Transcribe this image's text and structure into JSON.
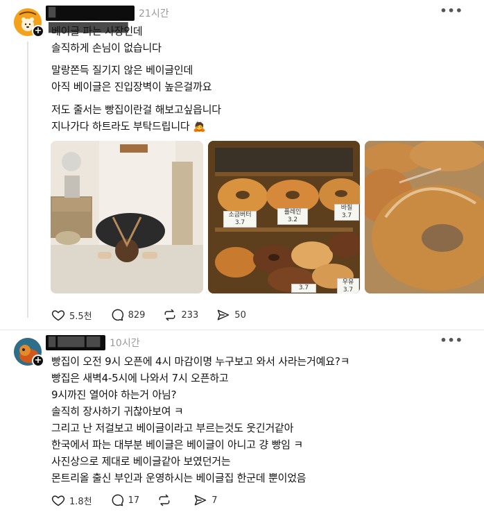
{
  "post1": {
    "username": "█ ████████████",
    "time": "21시간",
    "more": "•••",
    "lines": [
      "베이글 파는 사장인데",
      "솔직하게 손님이 없습니다",
      "",
      "말랑쫀득 질기지 않은 베이글인데",
      "아직 베이글은 진입장벽이 높은걸까요",
      "",
      "저도 줄서는 빵집이란걸 해보고싶읍니다",
      "지나가다 하트라도 부탁드립니다 🙇"
    ],
    "avatar_icon": "bear-bagel-logo",
    "price_tags": [
      {
        "name": "소금버터",
        "price": "3.7"
      },
      {
        "name": "플레인",
        "price": "3.2"
      },
      {
        "name": "바질",
        "price": "3.7"
      },
      {
        "name": "",
        "price": "3.7"
      },
      {
        "name": "우유",
        "price": "3.7"
      }
    ],
    "stats": {
      "likes": "5.5천",
      "comments": "829",
      "reposts": "233",
      "shares": "50"
    }
  },
  "post2": {
    "username": "█ ████ ██",
    "time": "10시간",
    "more": "•••",
    "lines": [
      "빵집이 오전 9시 오픈에 4시 마감이명 누구보고 와서 사라는거예요?ㅋ",
      "빵집은 새벽4-5시에 나와서 7시 오픈하고",
      "9시까진 열어야 하는거 아님?",
      "솔직히 장사하기 귀찮아보여 ㅋ",
      "그리고 난 저걸보고 베이글이라고 부르는것도 웃긴거같아",
      "한국에서 파는 대부분 베이글은 베이글이 아니고 걍 빵임 ㅋ",
      "사진상으로 제대로 베이글같아 보였던거는",
      "몬트리올 출신 부인과 운영하시는 베이글집 한군데 뿐이었음"
    ],
    "stats": {
      "likes": "1.8천",
      "comments": "17",
      "reposts": "",
      "shares": "7"
    }
  },
  "colors": {
    "text": "#111111",
    "muted": "#999999",
    "divider": "#e5e5e5"
  }
}
